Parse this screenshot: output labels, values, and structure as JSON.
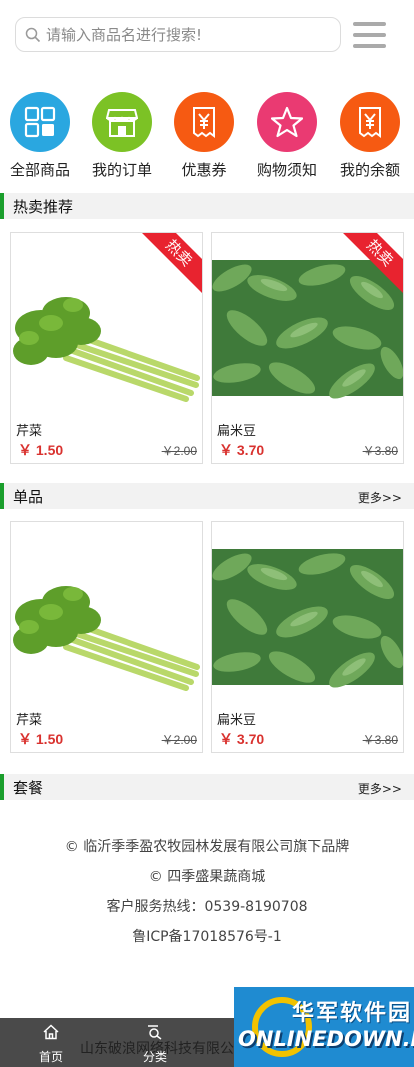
{
  "search": {
    "placeholder": "请输入商品名进行搜索!"
  },
  "categories": [
    {
      "label": "全部商品",
      "icon": "grid-icon",
      "color": "#2aa7e0"
    },
    {
      "label": "我的订单",
      "icon": "store-icon",
      "color": "#7cc225"
    },
    {
      "label": "优惠券",
      "icon": "yen-receipt-icon",
      "color": "#f65a12"
    },
    {
      "label": "购物须知",
      "icon": "star-icon",
      "color": "#ea3a72"
    },
    {
      "label": "我的余额",
      "icon": "yen-receipt-icon",
      "color": "#f65a12"
    }
  ],
  "sections": {
    "hot": {
      "title": "热卖推荐"
    },
    "single": {
      "title": "单品",
      "more": "更多>>"
    },
    "combo": {
      "title": "套餐",
      "more": "更多>>"
    }
  },
  "hot_products": [
    {
      "name": "芹菜",
      "price": "￥ 1.50",
      "old_price": "￥2.00",
      "badge": "热卖"
    },
    {
      "name": "扁米豆",
      "price": "￥ 3.70",
      "old_price": "￥3.80",
      "badge": "热卖"
    }
  ],
  "single_products": [
    {
      "name": "芹菜",
      "price": "￥ 1.50",
      "old_price": "￥2.00"
    },
    {
      "name": "扁米豆",
      "price": "￥ 3.70",
      "old_price": "￥3.80"
    }
  ],
  "footer": {
    "line1": "© 临沂季季盈农牧园林发展有限公司旗下品牌",
    "line2": "© 四季盛果蔬商城",
    "line3": "客户服务热线：0539-8190708",
    "line4": "鲁ICP备17018576号-1"
  },
  "bottom_nav": {
    "home": "首页",
    "category": "分类",
    "company": "山东破浪网络科技有限公"
  },
  "watermark": {
    "cn": "华军软件园",
    "en": "ONLINEDOWN.NET"
  },
  "colors": {
    "accent_green": "#1a9e2c",
    "price_red": "#d9322f",
    "badge_red": "#e8232f"
  }
}
